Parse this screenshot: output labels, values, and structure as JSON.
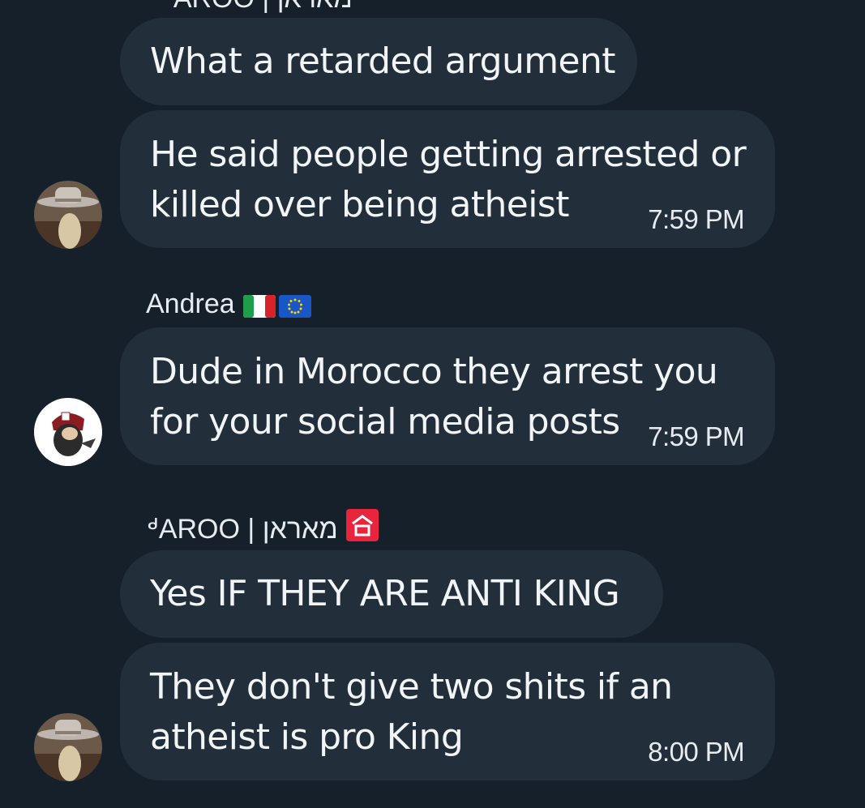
{
  "thread": {
    "top_sender_partial": "ᒄAROO | מאראן",
    "messages": [
      {
        "text": "What a retarded argument",
        "time": ""
      },
      {
        "text": "He said people getting arrested or\nkilled over being atheist",
        "time": "7:59 PM"
      },
      {
        "sender": "Andrea",
        "text": "Dude in Morocco they arrest you\nfor your social media posts",
        "time": "7:59 PM"
      },
      {
        "sender": "ᒄAROO | מאראן",
        "text": "Yes IF THEY ARE ANTI KING",
        "time": ""
      },
      {
        "text": "They don't give two shits if an\natheist is pro King",
        "time": "8:00 PM"
      }
    ]
  },
  "colors": {
    "background": "#15202b",
    "bubble": "#222f3b",
    "text": "#f2f5f7",
    "accent_badge": "#e8253d"
  },
  "icons": {
    "italy_flag": "italy-flag-icon",
    "eu_flag": "eu-flag-icon",
    "crown_icon": "crown-icon",
    "red_badge": "red-badge-icon"
  }
}
